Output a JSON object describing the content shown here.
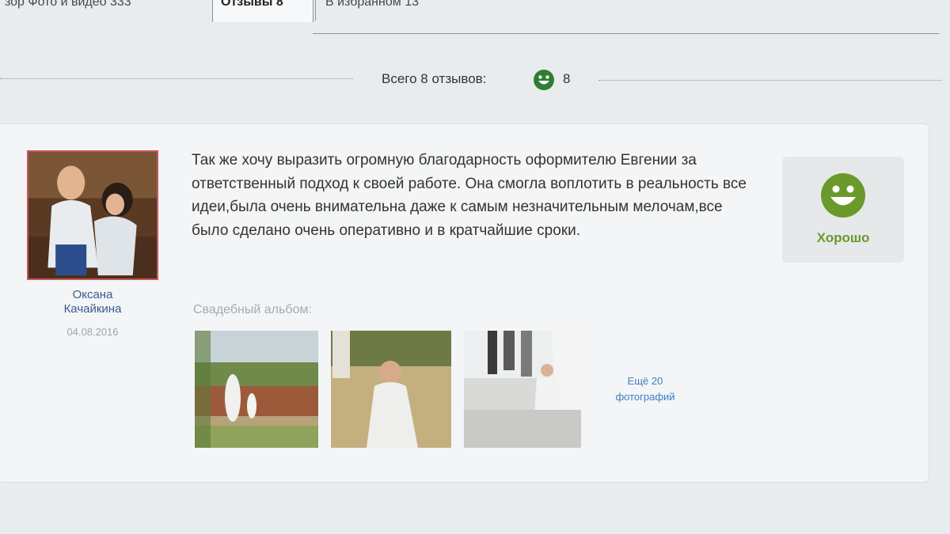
{
  "tabs": [
    {
      "label": "зор   Фото и видео 333"
    },
    {
      "label": "Отзывы 8"
    },
    {
      "label": "В избранном 13"
    }
  ],
  "summary": {
    "label": "Всего 8 отзывов:",
    "good_count": "8",
    "icon": "smiley-icon"
  },
  "review": {
    "author_first": "Оксана",
    "author_last": "Качайкина",
    "date": "04.08.2016",
    "text": "Так же хочу выразить огромную благодарность оформителю Евгении за ответственный подход к своей работе. Она смогла воплотить в реальность все идеи,была очень внимательна даже к самым незначительным мелочам,все было сделано очень оперативно и в кратчайшие сроки.",
    "rating_label": "Хорошо",
    "rating_icon": "smiley-icon",
    "album_title": "Свадебный альбом:",
    "more_line1": "Ещё 20",
    "more_line2": "фотографий"
  },
  "colors": {
    "rating_green": "#6b9a2c",
    "link_blue": "#3c7ec6",
    "author_blue": "#3a5c8c",
    "avatar_border": "#c8565c"
  }
}
